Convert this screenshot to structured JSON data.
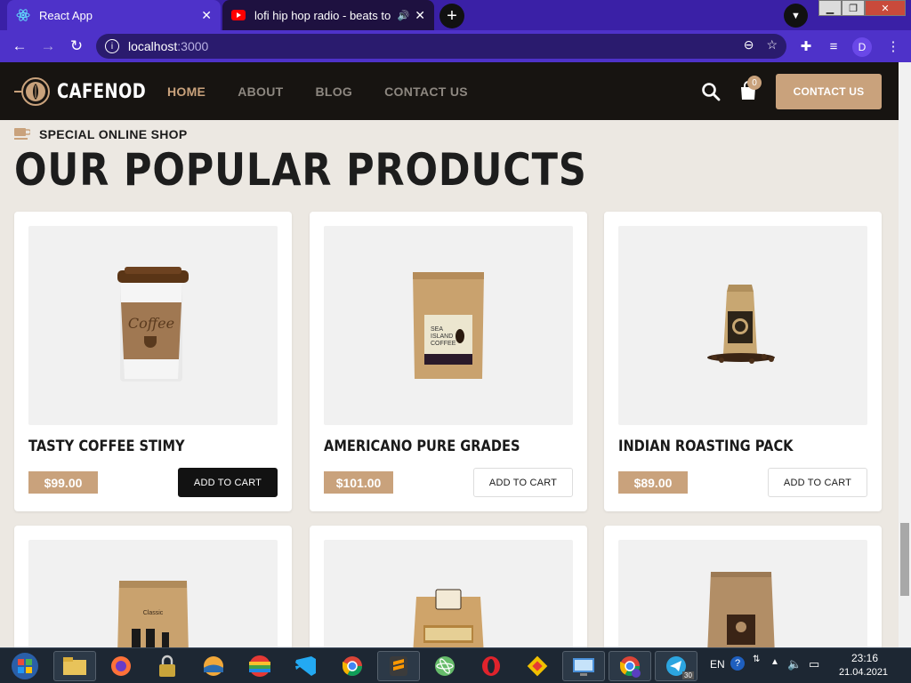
{
  "browser": {
    "tabs": [
      {
        "title": "React App",
        "icon": "react-icon",
        "active": true
      },
      {
        "title": "lofi hip hop radio - beats to r",
        "icon": "youtube-icon",
        "active": false
      }
    ],
    "url_host": "localhost",
    "url_port": ":3000",
    "profile_initial": "D"
  },
  "site": {
    "brand": "CAFENOD",
    "nav": [
      "HOME",
      "ABOUT",
      "BLOG",
      "CONTACT US"
    ],
    "active_nav": "HOME",
    "cart_count": "0",
    "contact_button": "CONTACT US"
  },
  "section": {
    "subtitle": "SPECIAL ONLINE SHOP",
    "title": "OUR POPULAR PRODUCTS"
  },
  "products": [
    {
      "name": "TASTY COFFEE STIMY",
      "price": "$99.00",
      "button": "ADD TO CART",
      "image": "coffee-cup"
    },
    {
      "name": "AMERICANO PURE GRADES",
      "price": "$101.00",
      "button": "ADD TO CART",
      "image": "coffee-pouch"
    },
    {
      "name": "INDIAN ROASTING PACK",
      "price": "$89.00",
      "button": "ADD TO CART",
      "image": "coffee-bag-beans"
    },
    {
      "name": "",
      "price": "",
      "button": "",
      "image": "classic-pouch"
    },
    {
      "name": "",
      "price": "",
      "button": "",
      "image": "arabica-bag"
    },
    {
      "name": "",
      "price": "",
      "button": "",
      "image": "kraft-bag"
    }
  ],
  "taskbar": {
    "language": "EN",
    "time": "23:16",
    "date": "21.04.2021",
    "telegram_badge": "30"
  },
  "colors": {
    "accent": "#c9a27c",
    "header_bg": "#171411",
    "page_bg": "#ece8e2",
    "browser_purple": "#4e32c9"
  }
}
